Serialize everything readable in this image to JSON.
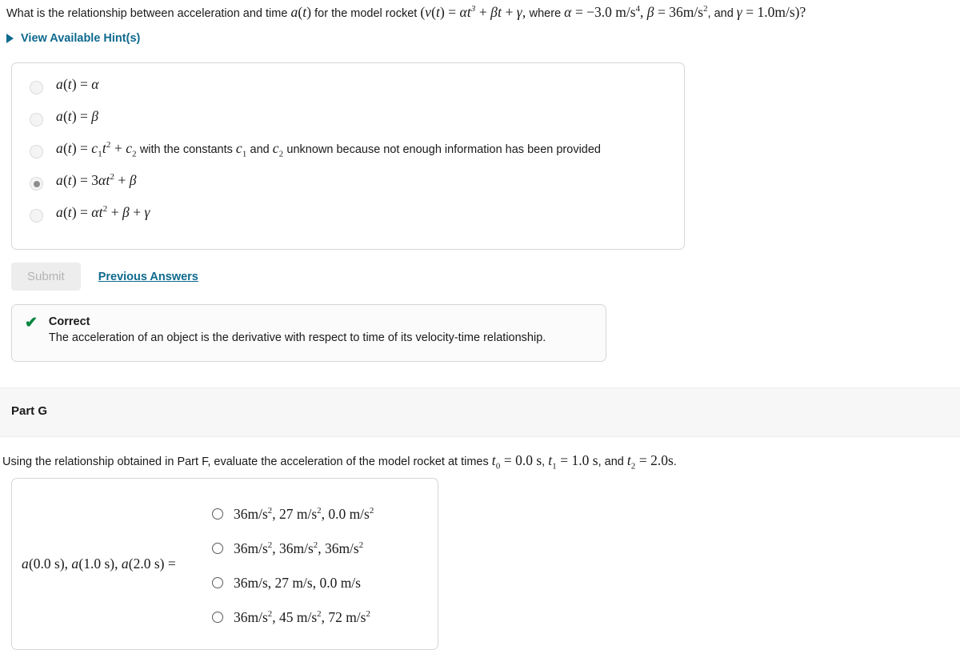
{
  "part_f": {
    "prompt_segments": [
      {
        "t": "What is the relationship between acceleration and time ",
        "k": "plain"
      },
      {
        "t": "a(t)",
        "k": "math"
      },
      {
        "t": " for the model rocket ",
        "k": "plain"
      },
      {
        "t": "(v(t) = αt³ + βt + γ, ",
        "k": "math"
      },
      {
        "t": "where ",
        "k": "plain"
      },
      {
        "t": "α = −3.0 m/s⁴, β = 36m/s², ",
        "k": "math"
      },
      {
        "t": "and ",
        "k": "plain"
      },
      {
        "t": "γ = 1.0m/s)?",
        "k": "math"
      }
    ],
    "prompt_plain": "What is the relationship between acceleration and time a(t) for the model rocket (v(t) = αt³ + βt + γ, where α = −3.0 m/s⁴, β = 36m/s², and γ = 1.0m/s)?",
    "hint_label": "View Available Hint(s)",
    "hint_icon": "triangle-right-icon",
    "options": [
      {
        "id": "f-opt-1",
        "text": "a(t) = α",
        "selected": false
      },
      {
        "id": "f-opt-2",
        "text": "a(t) = β",
        "selected": false
      },
      {
        "id": "f-opt-3",
        "text": "a(t) = c₁t² + c₂ with the constants c₁ and c₂ unknown because not enough information has been provided",
        "selected": false
      },
      {
        "id": "f-opt-4",
        "text": "a(t) = 3αt² + β",
        "selected": true
      },
      {
        "id": "f-opt-5",
        "text": "a(t) = αt² + β + γ",
        "selected": false
      }
    ],
    "option3_tail": " with the constants ",
    "option3_mid": " and ",
    "option3_end": " unknown because not enough information has been provided",
    "submit_label": "Submit",
    "submit_disabled": true,
    "previous_answers_label": "Previous Answers",
    "feedback": {
      "icon": "check-icon",
      "title": "Correct",
      "body": "The acceleration of an object is the derivative with respect to time of its velocity-time relationship.",
      "icon_glyph": "✔"
    }
  },
  "part_g": {
    "band_title": "Part G",
    "prompt_plain": "Using the relationship obtained in Part F, evaluate the acceleration of the model rocket at times t₀ = 0.0 s, t₁ = 1.0 s, and t₂ = 2.0s.",
    "prompt_lead": "Using the relationship obtained in Part F, evaluate the acceleration of the model rocket at times ",
    "prompt_mid1": ", ",
    "prompt_mid2": ", and ",
    "prompt_end": ".",
    "label_plain": "a(0.0 s), a(1.0 s), a(2.0 s) =",
    "options": [
      {
        "id": "g-opt-1",
        "text": "36m/s², 27 m/s², 0.0 m/s²",
        "selected": false
      },
      {
        "id": "g-opt-2",
        "text": "36m/s², 36m/s², 36m/s²",
        "selected": false
      },
      {
        "id": "g-opt-3",
        "text": "36m/s, 27 m/s, 0.0 m/s",
        "selected": false
      },
      {
        "id": "g-opt-4",
        "text": "36m/s², 45 m/s², 72 m/s²",
        "selected": false
      }
    ]
  },
  "colors": {
    "link": "#0f6a8e",
    "correct": "#00853e",
    "band_bg": "#f7f7f7",
    "card_border": "#d6d6d6",
    "submit_disabled_bg": "#ededed",
    "submit_disabled_text": "#b4b4b4"
  }
}
